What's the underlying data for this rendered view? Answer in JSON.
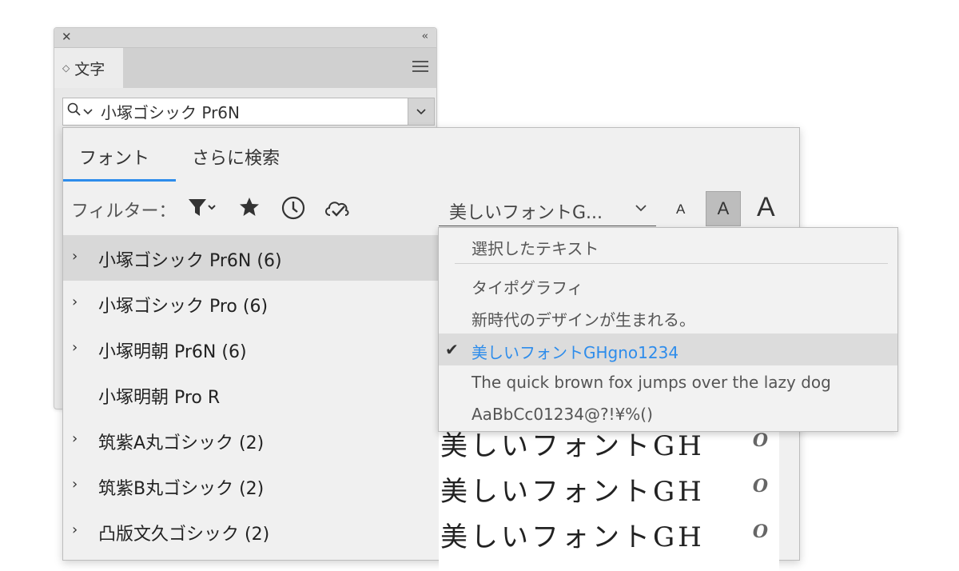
{
  "panel": {
    "close_glyph": "✕",
    "collapse_glyph": "‹‹",
    "tab_label": "文字",
    "font_field_value": "小塚ゴシック Pr6N"
  },
  "fontmenu": {
    "tabs": [
      "フォント",
      "さらに検索"
    ],
    "filter_label": "フィルター：",
    "sample_selected": "美しいフォントG...",
    "size_small": "A",
    "size_medium": "A",
    "size_large": "A",
    "families": [
      {
        "name": "小塚ゴシック Pr6N (6)",
        "expandable": true,
        "selected": true
      },
      {
        "name": "小塚ゴシック Pro (6)",
        "expandable": true
      },
      {
        "name": "小塚明朝 Pr6N (6)",
        "expandable": true
      },
      {
        "name": "小塚明朝 Pro R",
        "expandable": false
      },
      {
        "name": "筑紫A丸ゴシック (2)",
        "expandable": true
      },
      {
        "name": "筑紫B丸ゴシック (2)",
        "expandable": true
      },
      {
        "name": "凸版文久ゴシック (2)",
        "expandable": true
      }
    ],
    "preview_text": "美しいフォントGHg",
    "opentype_glyph": "O"
  },
  "sample_menu": {
    "items": [
      "選択したテキスト",
      "タイポグラフィ",
      "新時代のデザインが生まれる。",
      "美しいフォントGHgno1234",
      "The quick brown fox jumps over the lazy dog",
      "AaBbCc01234@?!¥%()"
    ],
    "checked_index": 3,
    "check_glyph": "✔"
  },
  "colors": {
    "accent": "#2d8ceb",
    "selected_row": "#d8d8d8"
  }
}
